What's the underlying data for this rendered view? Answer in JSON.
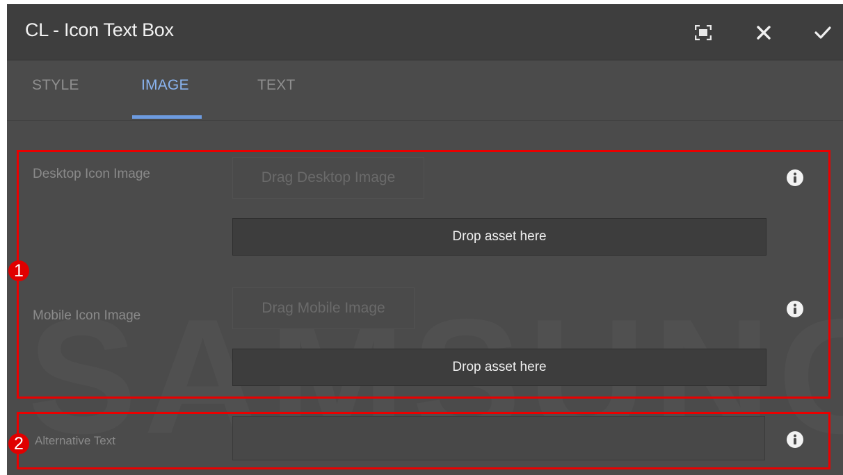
{
  "dialog": {
    "title": "CL - Icon Text Box",
    "header_buttons": [
      {
        "name": "fullscreen-icon"
      },
      {
        "name": "close-icon"
      },
      {
        "name": "checkmark-icon"
      }
    ]
  },
  "tabs": [
    {
      "label": "STYLE",
      "active": false
    },
    {
      "label": "IMAGE",
      "active": true
    },
    {
      "label": "TEXT",
      "active": false
    }
  ],
  "watermark": "SAMSUNG",
  "fields": {
    "desktop": {
      "label": "Desktop Icon Image",
      "drag_button": "Drag Desktop Image",
      "dropzone": "Drop asset here"
    },
    "mobile": {
      "label": "Mobile Icon Image",
      "drag_button": "Drag Mobile Image",
      "dropzone": "Drop asset here"
    },
    "alt_text": {
      "label": "Alternative Text",
      "value": ""
    }
  },
  "annotations": [
    "1",
    "2"
  ],
  "colors": {
    "header_bg": "#3e3e3e",
    "panel_bg": "#4b4b4b",
    "active_tab": "#8ab4f0",
    "highlight": "#ea0000"
  }
}
